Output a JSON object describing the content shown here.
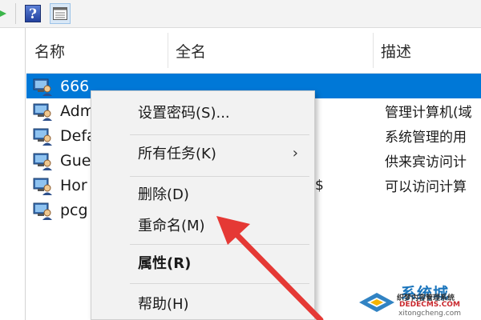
{
  "toolbar": {
    "icons": [
      "green-arrow-icon",
      "help-icon",
      "view-icon"
    ],
    "help_glyph": "?"
  },
  "columns": [
    "名称",
    "全名",
    "描述"
  ],
  "users": [
    {
      "name": "666",
      "fullname": "",
      "description": "",
      "selected": true
    },
    {
      "name": "Adm",
      "fullname": "",
      "description": "管理计算机(域",
      "selected": false
    },
    {
      "name": "Defa",
      "fullname": "",
      "description": "系统管理的用",
      "selected": false
    },
    {
      "name": "Gue",
      "fullname": "",
      "description": "供来宾访问计",
      "selected": false
    },
    {
      "name": "Hor",
      "fullname": "$",
      "description": "可以访问计算",
      "selected": false
    },
    {
      "name": "pcg",
      "fullname": "",
      "description": "",
      "selected": false
    }
  ],
  "context_menu": {
    "set_password": "设置密码(S)...",
    "all_tasks": "所有任务(K)",
    "all_tasks_arrow": "›",
    "delete": "删除(D)",
    "rename": "重命名(M)",
    "properties": "属性(R)",
    "help": "帮助(H)"
  },
  "watermark": {
    "brand": "系统城",
    "line1": "织梦内容管理系统",
    "line2": "DEDECMS.COM",
    "line3": "xitongcheng.com"
  },
  "colors": {
    "selection": "#0078d7",
    "annotation_arrow": "#e53935",
    "menu_bg": "#f2f2f2"
  }
}
